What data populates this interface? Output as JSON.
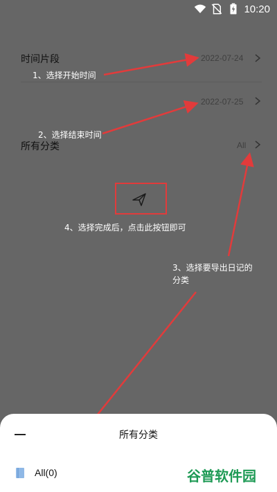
{
  "status_bar": {
    "time": "10:20",
    "icons": [
      "wifi-icon",
      "no-sim-icon",
      "battery-charging-icon"
    ]
  },
  "filters": {
    "time_range_label": "时间片段",
    "start_date": "2022-07-24",
    "end_date": "2022-07-25",
    "category_label": "所有分类",
    "category_value": "All"
  },
  "annotations": {
    "step1": "1、选择开始时间",
    "step2": "2、选择结束时间",
    "step3_line1": "3、选择要导出日记的",
    "step3_line2": "分类",
    "step4": "4、选择完成后，点击此按钮即可"
  },
  "bottom_sheet": {
    "title": "所有分类",
    "items": [
      {
        "label": "All(0)",
        "icon": "book-icon"
      }
    ]
  },
  "watermark": {
    "text": "谷普软件园"
  },
  "colors": {
    "overlay_background": "#666666",
    "annotation_arrow": "#e23b3b",
    "watermark": "#1e9a55"
  }
}
